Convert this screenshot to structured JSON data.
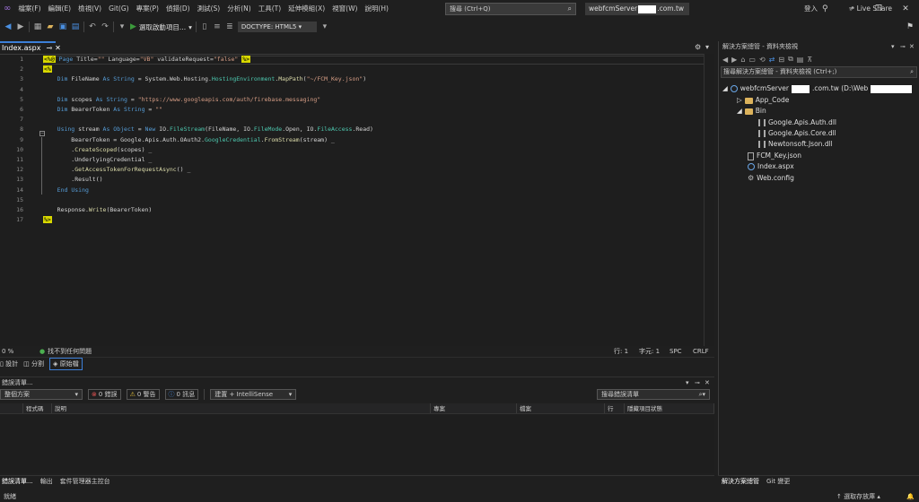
{
  "menu": [
    "檔案(F)",
    "編輯(E)",
    "檢視(V)",
    "Git(G)",
    "專案(P)",
    "偵錯(D)",
    "測試(S)",
    "分析(N)",
    "工具(T)",
    "延伸模組(X)",
    "視窗(W)",
    "說明(H)"
  ],
  "search": {
    "placeholder": "搜尋 (Ctrl+Q)"
  },
  "title": {
    "prefix": "webfcmServer",
    "suffix": ".com.tw"
  },
  "account": "登入",
  "toolbar": {
    "run_label": "選取啟動項目...",
    "doctype": "DOCTYPE: HTML5"
  },
  "live_share": "Live Share",
  "editor": {
    "tab_label": "Index.aspx",
    "lines": [
      "1",
      "2",
      "3",
      "4",
      "5",
      "6",
      "7",
      "8",
      "9",
      "10",
      "11",
      "12",
      "13",
      "14",
      "15",
      "16",
      "17"
    ]
  },
  "editor_status": {
    "zoom": "0 %",
    "issues": "找不到任何問題",
    "line": "行: 1",
    "col": "字元: 1",
    "spc": "SPC",
    "crlf": "CRLF"
  },
  "view_tabs": {
    "design": "設計",
    "split": "分割",
    "source": "原始檔"
  },
  "error_list": {
    "title": "錯誤清單...",
    "scope": "整個方案",
    "errors": "0 錯誤",
    "warnings": "0 警告",
    "messages": "0 訊息",
    "build": "建置 + IntelliSense",
    "search": "搜尋錯誤清單",
    "cols": [
      "程式碼",
      "說明",
      "專案",
      "檔案",
      "行",
      "隱藏項目狀態"
    ]
  },
  "bottom_tabs": [
    "錯誤清單...",
    "輸出",
    "套件管理器主控台"
  ],
  "statusbar": {
    "ready": "就緒",
    "source_control": "選取存放庫"
  },
  "solution": {
    "title": "解決方案總管 - 資料夾檢視",
    "search": "搜尋解決方案總管 - 資料夾檢視 (Ctrl+;)",
    "root": "webfcmServer",
    "root_suffix": ".com.tw (D:\\Web",
    "items": [
      "App_Code",
      "Bin",
      "Google.Apis.Auth.dll",
      "Google.Apis.Core.dll",
      "Newtonsoft.Json.dll",
      "FCM_Key.json",
      "Index.aspx",
      "Web.config"
    ],
    "bottom_tabs": [
      "解決方案總管",
      "Git 變更"
    ]
  }
}
